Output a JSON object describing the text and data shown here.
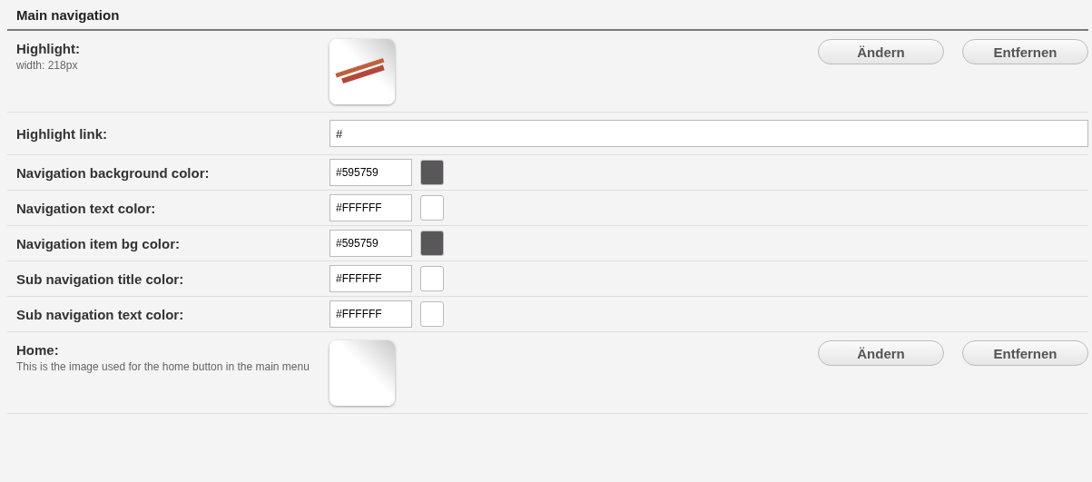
{
  "section": {
    "title": "Main navigation"
  },
  "rows": [
    {
      "kind": "image",
      "label": "Highlight:",
      "hint": "width: 218px",
      "buttons": [
        "Ändern",
        "Entfernen"
      ]
    },
    {
      "kind": "text",
      "label": "Highlight link:",
      "value": "#"
    },
    {
      "kind": "color",
      "label": "Navigation background color:",
      "value": "#595759",
      "color": "#595759"
    },
    {
      "kind": "color",
      "label": "Navigation text color:",
      "value": "#FFFFFF",
      "color": "#ffffff"
    },
    {
      "kind": "color",
      "label": "Navigation item bg color:",
      "value": "#595759",
      "color": "#595759"
    },
    {
      "kind": "color",
      "label": "Sub navigation title color:",
      "value": "#FFFFFF",
      "color": "#ffffff"
    },
    {
      "kind": "color",
      "label": "Sub navigation text color:",
      "value": "#FFFFFF",
      "color": "#ffffff"
    },
    {
      "kind": "image",
      "label": "Home:",
      "hint": "This is the image used for the home button in the main menu",
      "buttons": [
        "Ändern",
        "Entfernen"
      ]
    }
  ]
}
